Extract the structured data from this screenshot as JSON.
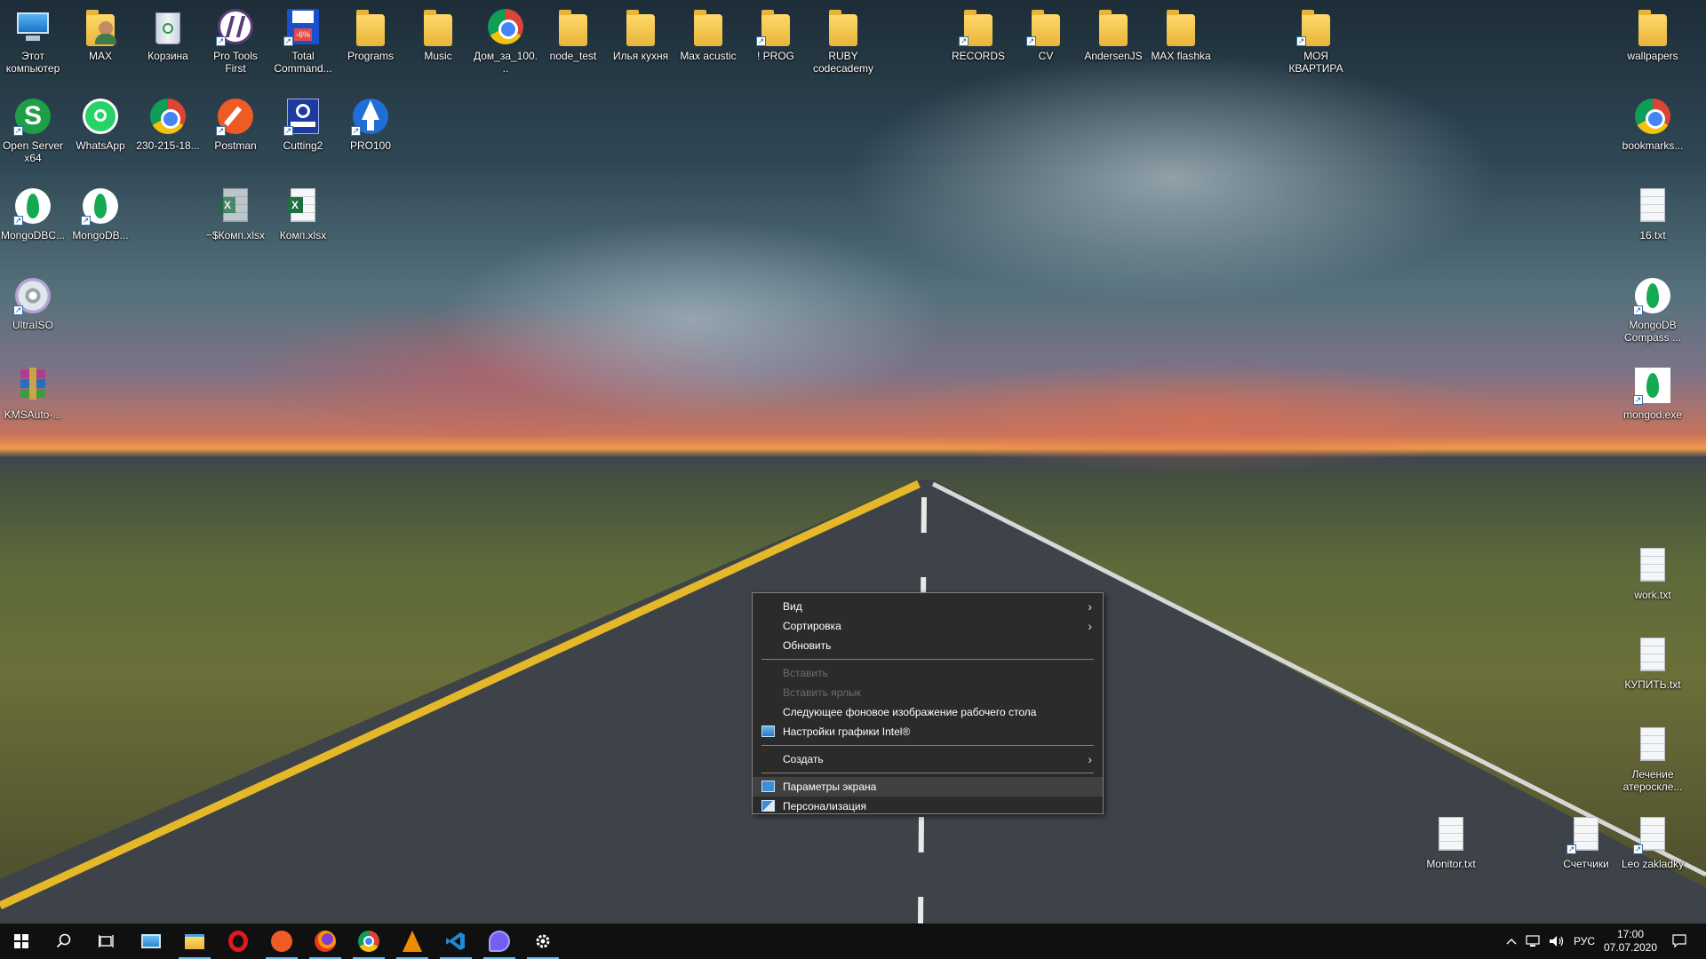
{
  "desktop": {
    "icons_left": [
      {
        "label": "Этот компьютер",
        "icon": "computer-icon"
      },
      {
        "label": "MAX",
        "icon": "user-folder-icon"
      },
      {
        "label": "Корзина",
        "icon": "recycle-bin-icon"
      },
      {
        "label": "Pro Tools First",
        "icon": "pro-tools-icon"
      },
      {
        "label": "Total Command...",
        "icon": "total-commander-icon"
      },
      {
        "label": "Programs",
        "icon": "folder-icon"
      },
      {
        "label": "Music",
        "icon": "folder-icon"
      },
      {
        "label": "Дом_за_100...",
        "icon": "chrome-icon"
      },
      {
        "label": "node_test",
        "icon": "folder-icon"
      },
      {
        "label": "Илья кухня",
        "icon": "folder-icon"
      },
      {
        "label": "Max acustic",
        "icon": "folder-icon"
      },
      {
        "label": "! PROG",
        "icon": "folder-icon"
      },
      {
        "label": "RUBY codecademy",
        "icon": "folder-icon"
      },
      {
        "label": "RECORDS",
        "icon": "folder-icon"
      },
      {
        "label": "CV",
        "icon": "folder-icon"
      },
      {
        "label": "AndersenJS",
        "icon": "folder-icon"
      },
      {
        "label": "MAX flashka",
        "icon": "folder-icon"
      },
      {
        "label": "МОЯ КВАРТИРА",
        "icon": "folder-icon"
      },
      {
        "label": "wallpapers",
        "icon": "folder-icon"
      },
      {
        "label": "Open Server x64",
        "icon": "open-server-icon"
      },
      {
        "label": "WhatsApp",
        "icon": "whatsapp-icon"
      },
      {
        "label": "230-215-18...",
        "icon": "chrome-icon"
      },
      {
        "label": "Postman",
        "icon": "postman-icon"
      },
      {
        "label": "Cutting2",
        "icon": "cutting-icon"
      },
      {
        "label": "PRO100",
        "icon": "pro100-icon"
      },
      {
        "label": "bookmarks...",
        "icon": "chrome-icon"
      },
      {
        "label": "MongoDBC...",
        "icon": "mongodb-icon"
      },
      {
        "label": "MongoDB...",
        "icon": "mongodb-icon"
      },
      {
        "label": "~$Комп.xlsx",
        "icon": "excel-icon"
      },
      {
        "label": "Комп.xlsx",
        "icon": "excel-icon"
      },
      {
        "label": "16.txt",
        "icon": "text-file-icon"
      },
      {
        "label": "UltraISO",
        "icon": "ultraiso-icon"
      },
      {
        "label": "MongoDB Compass ...",
        "icon": "mongodb-icon"
      },
      {
        "label": "KMSAuto-...",
        "icon": "winrar-icon"
      },
      {
        "label": "mongod.exe",
        "icon": "mongodb-icon"
      },
      {
        "label": "work.txt",
        "icon": "text-file-icon"
      },
      {
        "label": "КУПИТЬ.txt",
        "icon": "text-file-icon"
      },
      {
        "label": "Лечение атероскле...",
        "icon": "text-file-icon"
      },
      {
        "label": "Monitor.txt",
        "icon": "text-file-icon"
      },
      {
        "label": "Счетчики",
        "icon": "text-file-icon"
      },
      {
        "label": "Leo zakladky",
        "icon": "text-file-icon"
      }
    ]
  },
  "context_menu": {
    "items": [
      {
        "label": "Вид",
        "submenu": true,
        "enabled": true
      },
      {
        "label": "Сортировка",
        "submenu": true,
        "enabled": true
      },
      {
        "label": "Обновить",
        "submenu": false,
        "enabled": true
      },
      {
        "label": "Вставить",
        "submenu": false,
        "enabled": false
      },
      {
        "label": "Вставить ярлык",
        "submenu": false,
        "enabled": false
      },
      {
        "label": "Следующее фоновое изображение рабочего стола",
        "submenu": false,
        "enabled": true
      },
      {
        "label": "Настройки графики Intel®",
        "submenu": false,
        "enabled": true,
        "icon": "intel-graphics-icon"
      },
      {
        "label": "Создать",
        "submenu": true,
        "enabled": true
      },
      {
        "label": "Параметры экрана",
        "submenu": false,
        "enabled": true,
        "icon": "display-settings-icon",
        "highlighted": true
      },
      {
        "label": "Персонализация",
        "submenu": false,
        "enabled": true,
        "icon": "personalization-icon"
      }
    ],
    "arrow_glyph": "›"
  },
  "taskbar": {
    "apps": [
      {
        "name": "start-button",
        "icon": "windows-icon"
      },
      {
        "name": "search-button",
        "icon": "search-icon"
      },
      {
        "name": "task-view-button",
        "icon": "task-view-icon"
      },
      {
        "name": "app-remote-desktop",
        "icon": "remote-desktop-icon"
      },
      {
        "name": "app-file-explorer",
        "icon": "folder-icon"
      },
      {
        "name": "app-opera",
        "icon": "opera-icon"
      },
      {
        "name": "app-postman",
        "icon": "postman-icon"
      },
      {
        "name": "app-firefox",
        "icon": "firefox-icon"
      },
      {
        "name": "app-chrome",
        "icon": "chrome-icon"
      },
      {
        "name": "app-vlc",
        "icon": "vlc-icon"
      },
      {
        "name": "app-vscode",
        "icon": "vscode-icon"
      },
      {
        "name": "app-viber",
        "icon": "viber-icon"
      },
      {
        "name": "app-settings",
        "icon": "gear-icon"
      }
    ],
    "tray": {
      "language": "РУС",
      "time": "17:00",
      "date": "07.07.2020"
    }
  },
  "colors": {
    "menu_bg": "#2b2b2b",
    "menu_border": "#808080",
    "menu_highlight": "#414141",
    "menu_disabled_text": "#6d6d6d",
    "taskbar_bg": "#101010",
    "taskbar_active": "#76b9ed"
  }
}
